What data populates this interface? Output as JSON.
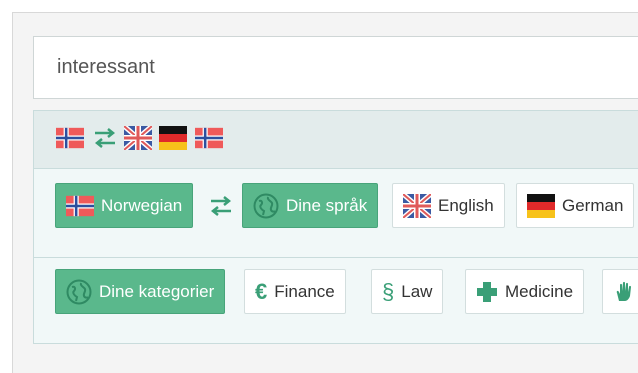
{
  "search": {
    "value": "interessant"
  },
  "direction_flags": [
    "flag-norway-icon",
    "swap-arrows-icon",
    "flag-uk-icon",
    "flag-germany-icon",
    "flag-norway-icon"
  ],
  "languages": {
    "source": {
      "label": "Norwegian",
      "icon": "flag-norway-icon"
    },
    "swap_icon": "swap-arrows-icon",
    "targets": [
      {
        "label": "Dine språk",
        "icon": "globe-icon",
        "selected": true
      },
      {
        "label": "English",
        "icon": "flag-uk-icon",
        "selected": false
      },
      {
        "label": "German",
        "icon": "flag-germany-icon",
        "selected": false
      }
    ]
  },
  "categories": {
    "items": [
      {
        "label": "Dine kategorier",
        "icon": "globe-icon",
        "selected": true
      },
      {
        "label": "Finance",
        "icon": "euro-icon",
        "selected": false
      },
      {
        "label": "Law",
        "icon": "section-sign-icon",
        "selected": false
      },
      {
        "label": "Medicine",
        "icon": "medical-cross-icon",
        "selected": false
      },
      {
        "label": "",
        "icon": "hand-icon",
        "selected": false
      }
    ]
  },
  "colors": {
    "selected_bg": "#5ab88c",
    "accent": "#3a9f77",
    "panel_bg": "#f1f8f8",
    "strip_bg": "#e3ecec"
  }
}
